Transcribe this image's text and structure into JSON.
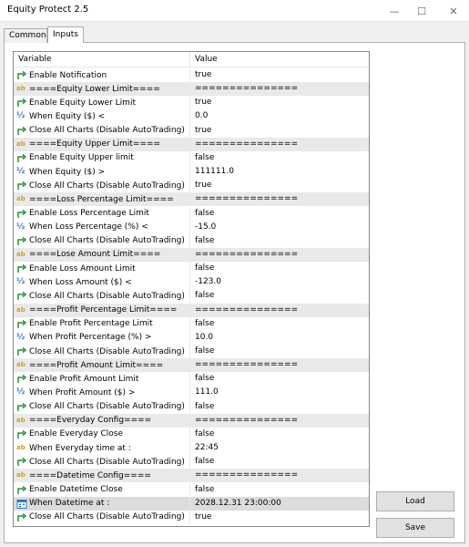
{
  "window": {
    "title": "Equity Protect 2.5",
    "min_glyph": "—",
    "max_glyph": "☐",
    "close_glyph": "✕"
  },
  "tabs": [
    {
      "label": "Common"
    },
    {
      "label": "Inputs"
    }
  ],
  "grid": {
    "headers": {
      "variable": "Variable",
      "value": "Value"
    },
    "rows": [
      {
        "icon": "bool-arrow",
        "name": "Enable Notification",
        "value": "true"
      },
      {
        "icon": "ab",
        "name": "====Equity Lower Limit====",
        "value": "==============="
      },
      {
        "icon": "bool-arrow",
        "name": "Enable Equity Lower Limit",
        "value": "true"
      },
      {
        "icon": "half",
        "name": "When Equity ($) <",
        "value": "0.0"
      },
      {
        "icon": "bool-arrow",
        "name": "Close All Charts (Disable AutoTrading)",
        "value": "true"
      },
      {
        "icon": "ab",
        "name": "====Equity Upper Limit====",
        "value": "==============="
      },
      {
        "icon": "bool-arrow",
        "name": "Enable Equity Upper limit",
        "value": "false"
      },
      {
        "icon": "half",
        "name": "When Equity ($) >",
        "value": "111111.0"
      },
      {
        "icon": "bool-arrow",
        "name": "Close All Charts (Disable AutoTrading)",
        "value": "true"
      },
      {
        "icon": "ab",
        "name": "====Loss Percentage Limit====",
        "value": "==============="
      },
      {
        "icon": "bool-arrow",
        "name": "Enable Loss Percentage Limit",
        "value": "false"
      },
      {
        "icon": "half",
        "name": "When Loss Percentage (%) <",
        "value": "-15.0"
      },
      {
        "icon": "bool-arrow",
        "name": "Close All Charts (Disable AutoTrading)",
        "value": "false"
      },
      {
        "icon": "ab",
        "name": "====Lose Amount Limit====",
        "value": "==============="
      },
      {
        "icon": "bool-arrow",
        "name": "Enable Loss Amount Limit",
        "value": "false"
      },
      {
        "icon": "half",
        "name": "When Loss Amount ($) <",
        "value": "-123.0"
      },
      {
        "icon": "bool-arrow",
        "name": "Close All Charts (Disable AutoTrading)",
        "value": "false"
      },
      {
        "icon": "ab",
        "name": "====Profit Percentage Limit====",
        "value": "==============="
      },
      {
        "icon": "bool-arrow",
        "name": "Enable Profit Percentage Limit",
        "value": "false"
      },
      {
        "icon": "half",
        "name": "When Profit Percentage (%) >",
        "value": "10.0"
      },
      {
        "icon": "bool-arrow",
        "name": "Close All Charts (Disable AutoTrading)",
        "value": "false"
      },
      {
        "icon": "ab",
        "name": "====Profit Amount Limit====",
        "value": "==============="
      },
      {
        "icon": "bool-arrow",
        "name": "Enable Profit Amount Limit",
        "value": "false"
      },
      {
        "icon": "half",
        "name": "When Profit Amount ($) >",
        "value": "111.0"
      },
      {
        "icon": "bool-arrow",
        "name": "Close All Charts (Disable AutoTrading)",
        "value": "false"
      },
      {
        "icon": "ab",
        "name": "====Everyday Config====",
        "value": "==============="
      },
      {
        "icon": "bool-arrow",
        "name": "Enable Everyday Close",
        "value": "false"
      },
      {
        "icon": "ab",
        "name": "When Everyday time at :",
        "value": "22:45"
      },
      {
        "icon": "bool-arrow",
        "name": "Close All Charts (Disable AutoTrading)",
        "value": "false"
      },
      {
        "icon": "ab",
        "name": "====Datetime Config====",
        "value": "==============="
      },
      {
        "icon": "bool-arrow",
        "name": "Enable Datetime Close",
        "value": "false"
      },
      {
        "icon": "calendar",
        "name": "When Datetime at :",
        "value": "2028.12.31 23:00:00"
      },
      {
        "icon": "bool-arrow",
        "name": "Close All Charts (Disable AutoTrading)",
        "value": "true"
      }
    ]
  },
  "buttons": {
    "load": "Load",
    "save": "Save"
  },
  "colors": {
    "arrow_green": "#2e8b3e",
    "ab_gold": "#c9a227",
    "half_blue": "#3a6fc4",
    "calendar_blue": "#2f78c8"
  }
}
